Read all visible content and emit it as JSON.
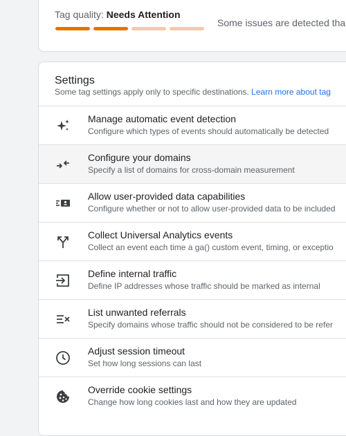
{
  "tag_quality": {
    "label": "Tag quality:",
    "status": "Needs Attention",
    "description": "Some issues are detected tha",
    "bar_colors": [
      "#e37400",
      "#e37400",
      "#f8c8a8",
      "#f8c8a8"
    ]
  },
  "settings": {
    "title": "Settings",
    "subtitle": "Some tag settings apply only to specific destinations.",
    "learn_more": "Learn more about tag",
    "items": [
      {
        "title": "Manage automatic event detection",
        "description": "Configure which types of events should automatically be detected",
        "icon": "sparkle-icon"
      },
      {
        "title": "Configure your domains",
        "description": "Specify a list of domains for cross-domain measurement",
        "icon": "arrows-merge-icon"
      },
      {
        "title": "Allow user-provided data capabilities",
        "description": "Configure whether or not to allow user-provided data to be included",
        "icon": "user-data-icon"
      },
      {
        "title": "Collect Universal Analytics events",
        "description": "Collect an event each time a ga() custom event, timing, or exceptio",
        "icon": "fork-arrow-icon"
      },
      {
        "title": "Define internal traffic",
        "description": "Define IP addresses whose traffic should be marked as internal",
        "icon": "login-box-icon"
      },
      {
        "title": "List unwanted referrals",
        "description": "Specify domains whose traffic should not be considered to be refer",
        "icon": "list-remove-icon"
      },
      {
        "title": "Adjust session timeout",
        "description": "Set how long sessions can last",
        "icon": "clock-icon"
      },
      {
        "title": "Override cookie settings",
        "description": "Change how long cookies last and how they are updated",
        "icon": "cookie-icon"
      }
    ]
  },
  "colors": {
    "accent_link": "#1a73e8",
    "warning": "#e37400"
  }
}
